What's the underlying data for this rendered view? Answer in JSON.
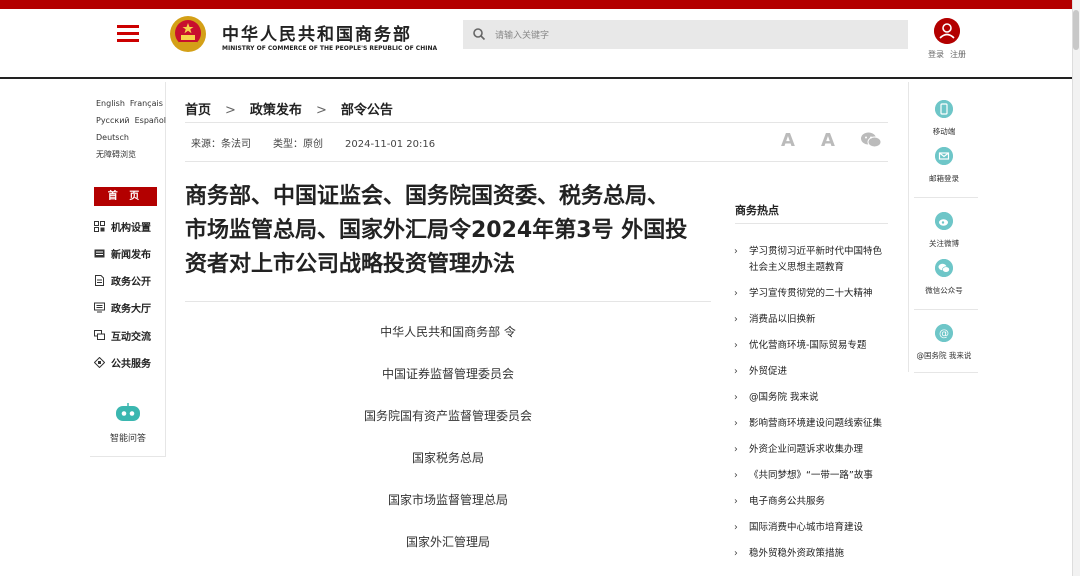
{
  "header": {
    "logo_cn": "中华人民共和国商务部",
    "logo_en": "MINISTRY OF COMMERCE OF THE PEOPLE'S REPUBLIC OF CHINA",
    "search_placeholder": "请输入关键字",
    "login": "登录",
    "register": "注册",
    "accent_color": "#b30000"
  },
  "langs": [
    "English",
    "Français",
    "Русский",
    "Español",
    "Deutsch",
    "无障碍浏览"
  ],
  "leftnav": {
    "home": "首 页",
    "items": [
      {
        "label": "机构设置",
        "icon": "org-icon"
      },
      {
        "label": "新闻发布",
        "icon": "news-icon"
      },
      {
        "label": "政务公开",
        "icon": "document-icon"
      },
      {
        "label": "政务大厅",
        "icon": "hall-icon"
      },
      {
        "label": "互动交流",
        "icon": "chat-icon"
      },
      {
        "label": "公共服务",
        "icon": "service-icon"
      }
    ],
    "assistant": "智能问答"
  },
  "breadcrumb": [
    "首页",
    "政策发布",
    "部令公告"
  ],
  "meta": {
    "source": "来源：条法司",
    "type": "类型：原创",
    "date": "2024-11-01 20:16"
  },
  "font_controls": {
    "large": "A",
    "small": "A"
  },
  "article": {
    "title_line1": "商务部、中国证监会、国务院国资委、税务总局、",
    "title_line2": "市场监管总局、国家外汇局令2024年第3号 外国投",
    "title_line3": "资者对上市公司战略投资管理办法",
    "issuers": [
      "中华人民共和国商务部 令",
      "中国证券监督管理委员会",
      "国务院国有资产监督管理委员会",
      "国家税务总局",
      "国家市场监督管理总局",
      "国家外汇管理局"
    ]
  },
  "hot": {
    "title": "商务热点",
    "items": [
      "学习贯彻习近平新时代中国特色社会主义思想主题教育",
      "学习宣传贯彻党的二十大精神",
      "消费品以旧换新",
      "优化营商环境-国际贸易专题",
      "外贸促进",
      "@国务院 我来说",
      "影响营商环境建设问题线索征集",
      "外资企业问题诉求收集办理",
      "《共同梦想》“一带一路”故事",
      "电子商务公共服务",
      "国际消费中心城市培育建设",
      "稳外贸稳外资政策措施"
    ]
  },
  "rightbar": {
    "items": [
      "移动端",
      "邮箱登录",
      "关注微博",
      "微信公众号",
      "@国务院 我来说"
    ]
  }
}
